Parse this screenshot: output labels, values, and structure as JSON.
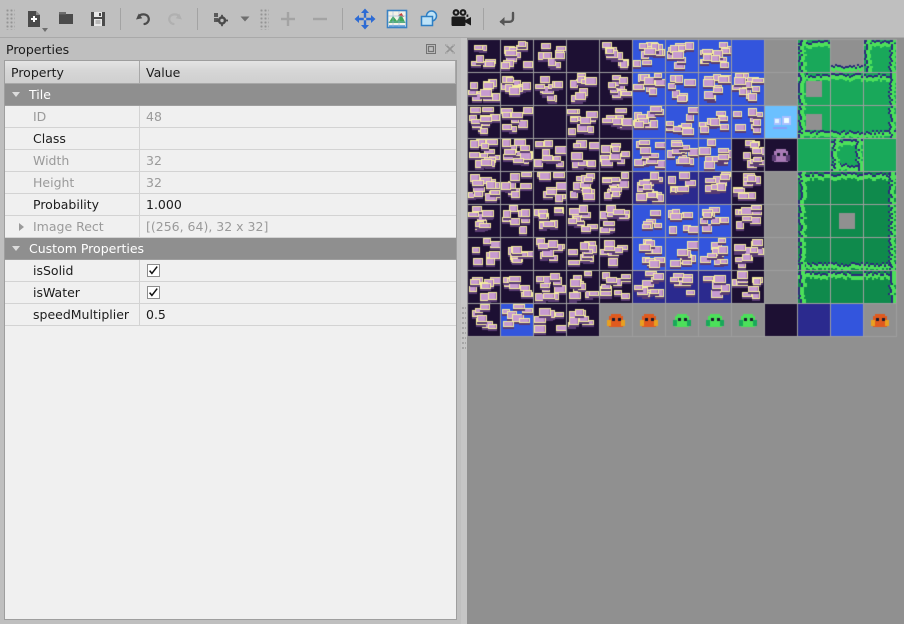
{
  "toolbar": {
    "items": [
      {
        "name": "new-map-button",
        "icon": "new-file-icon",
        "label": "New Map",
        "enabled": true,
        "has_dropdown": true
      },
      {
        "name": "open-file-button",
        "icon": "open-folder-icon",
        "label": "Open",
        "enabled": true,
        "has_dropdown": false
      },
      {
        "name": "save-button",
        "icon": "floppy-save-icon",
        "label": "Save",
        "enabled": true,
        "has_dropdown": false
      },
      {
        "name": "undo-button",
        "icon": "undo-arrow-icon",
        "label": "Undo",
        "enabled": true,
        "has_dropdown": false
      },
      {
        "name": "redo-button",
        "icon": "redo-arrow-icon",
        "label": "Redo",
        "enabled": false,
        "has_dropdown": false
      },
      {
        "name": "tileset-settings-button",
        "icon": "gear-tiles-icon",
        "label": "Tileset Properties",
        "enabled": true,
        "has_dropdown": true
      },
      {
        "name": "add-tiles-button",
        "icon": "plus-icon",
        "label": "Add Tiles",
        "enabled": false,
        "has_dropdown": false
      },
      {
        "name": "remove-tiles-button",
        "icon": "minus-icon",
        "label": "Remove Tiles",
        "enabled": false,
        "has_dropdown": false
      },
      {
        "name": "move-tool-button",
        "icon": "move-cross-arrows-icon",
        "label": "Move",
        "enabled": true,
        "has_dropdown": false
      },
      {
        "name": "edit-terrain-button",
        "icon": "terrain-map-icon",
        "label": "Edit Terrain Sets",
        "enabled": true,
        "has_dropdown": false
      },
      {
        "name": "edit-collision-button",
        "icon": "collision-shapes-icon",
        "label": "Edit Tile Collision",
        "enabled": true,
        "has_dropdown": false
      },
      {
        "name": "tile-animation-button",
        "icon": "movie-camera-icon",
        "label": "Tile Animation Editor",
        "enabled": true,
        "has_dropdown": false
      },
      {
        "name": "return-button",
        "icon": "return-arrow-icon",
        "label": "Return",
        "enabled": true,
        "has_dropdown": false
      }
    ]
  },
  "properties_panel": {
    "title": "Properties",
    "float_button_label": "Float",
    "close_button_label": "Close",
    "columns": [
      "Property",
      "Value"
    ],
    "groups": [
      {
        "name": "Tile",
        "expanded": true,
        "rows": [
          {
            "name": "ID",
            "value": "48",
            "disabled": true,
            "kind": "text",
            "expandable": false
          },
          {
            "name": "Class",
            "value": "",
            "disabled": false,
            "kind": "text",
            "expandable": false
          },
          {
            "name": "Width",
            "value": "32",
            "disabled": true,
            "kind": "text",
            "expandable": false
          },
          {
            "name": "Height",
            "value": "32",
            "disabled": true,
            "kind": "text",
            "expandable": false
          },
          {
            "name": "Probability",
            "value": "1.000",
            "disabled": false,
            "kind": "text",
            "expandable": false
          },
          {
            "name": "Image Rect",
            "value": "[(256, 64), 32 x 32]",
            "disabled": true,
            "kind": "text",
            "expandable": true
          }
        ]
      },
      {
        "name": "Custom Properties",
        "expanded": true,
        "rows": [
          {
            "name": "isSolid",
            "value": "",
            "checked": true,
            "disabled": false,
            "kind": "checkbox",
            "expandable": false
          },
          {
            "name": "isWater",
            "value": "",
            "checked": true,
            "disabled": false,
            "kind": "checkbox",
            "expandable": false
          },
          {
            "name": "speedMultiplier",
            "value": "0.5",
            "disabled": false,
            "kind": "text",
            "expandable": false
          }
        ]
      }
    ]
  },
  "tileset_view": {
    "name": "tileset-grid",
    "background_color": "#909090",
    "tile_size": 32,
    "grid_line_color": "#9e9e9e",
    "columns": 13,
    "rows": 9,
    "selected_tile_id": 48,
    "palette": {
      "void": "#1d1033",
      "rock_light": "#c79bd0",
      "rock_mid": "#a87ab5",
      "rock_dark": "#5a3c73",
      "rock_outline": "#f5eda0",
      "water_blue": "#3355dd",
      "water_light": "#4f8fe0",
      "deep_blue": "#2b2a8e",
      "grass_green": "#19a85a",
      "grass_light": "#4ce05a",
      "grass_dark": "#0f8a4c",
      "grass_outline": "#2a2a7a",
      "gray_bg": "#909090",
      "orange": "#e05a1e",
      "gold": "#e8a020"
    }
  }
}
